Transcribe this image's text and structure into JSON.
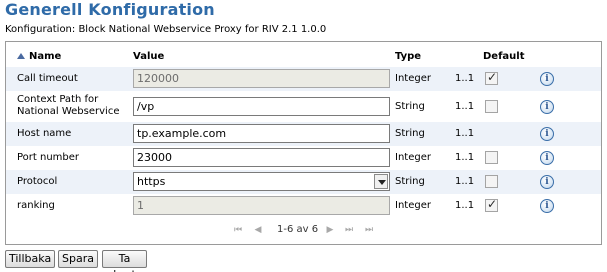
{
  "page": {
    "title": "Generell Konfiguration",
    "subtitle": "Konfiguration: Block National Webservice Proxy for RIV 2.1 1.0.0"
  },
  "table": {
    "columns": {
      "name": "Name",
      "value": "Value",
      "type": "Type",
      "default": "Default"
    },
    "rows": [
      {
        "name": "Call timeout",
        "value": "120000",
        "type": "Integer",
        "multiplicity": "1..1",
        "default_checked": true,
        "value_disabled": true,
        "has_checkbox": true
      },
      {
        "name": "Context Path for National Webservice",
        "value": "/vp",
        "type": "String",
        "multiplicity": "1..1",
        "default_checked": false,
        "value_disabled": false,
        "has_checkbox": true
      },
      {
        "name": "Host name",
        "value": "tp.example.com",
        "type": "String",
        "multiplicity": "1..1",
        "default_checked": false,
        "value_disabled": false,
        "has_checkbox": false
      },
      {
        "name": "Port number",
        "value": "23000",
        "type": "Integer",
        "multiplicity": "1..1",
        "default_checked": false,
        "value_disabled": false,
        "has_checkbox": true
      },
      {
        "name": "Protocol",
        "value": "https",
        "type": "String",
        "multiplicity": "1..1",
        "default_checked": false,
        "value_disabled": false,
        "has_checkbox": true,
        "is_select": true
      },
      {
        "name": "ranking",
        "value": "1",
        "type": "Integer",
        "multiplicity": "1..1",
        "default_checked": true,
        "value_disabled": true,
        "has_checkbox": true
      }
    ],
    "info_icon": "info-icon"
  },
  "pager": {
    "info": "1-6 av 6",
    "icons": [
      "first-page-icon",
      "prev-page-icon",
      "next-page-icon",
      "last-page-icon"
    ]
  },
  "buttons": {
    "back": "Tillbaka",
    "save": "Spara",
    "delete": "Ta bort"
  },
  "colors": {
    "title": "#2f6ba8",
    "alt_row": "#edf2f9",
    "info_icon": "#3a6ea8"
  }
}
